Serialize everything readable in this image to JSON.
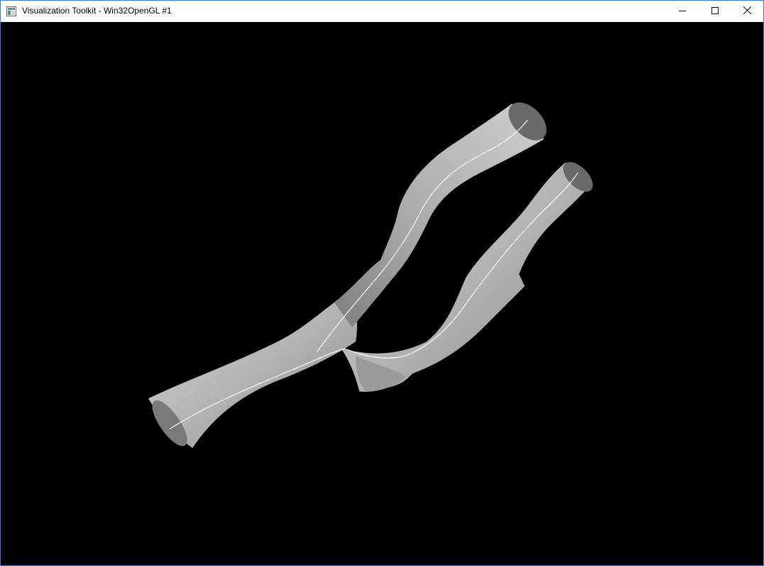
{
  "window": {
    "title": "Visualization Toolkit - Win32OpenGL #1",
    "icon": "vtk-app-icon",
    "accent_border": "#3a7bd5"
  },
  "caption_buttons": {
    "minimize": "minimize-icon",
    "maximize": "maximize-icon",
    "close": "close-icon"
  },
  "render_view": {
    "background": "#000000",
    "object": "vessel-bifurcation-surface",
    "surface_color": "#bdbdbd",
    "centerline_color": "#ffffff"
  }
}
